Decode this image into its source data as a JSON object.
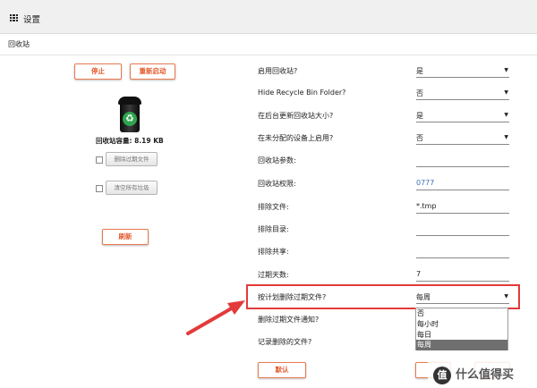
{
  "app": {
    "title": "设置",
    "grid_icon": "grid-icon"
  },
  "breadcrumb": "回收站",
  "left": {
    "stop_button": "停止",
    "restart_button": "重新启动",
    "trash_icon": "trash-can-icon",
    "recycle_symbol": "♻",
    "usage": "回收站容量: 8.19 KB",
    "delete_expired_button": "删除过期文件",
    "empty_all_button": "清空所有垃圾",
    "refresh_button": "刷新"
  },
  "settings": {
    "enable_recycle": {
      "label": "启用回收站?",
      "value": "是"
    },
    "hide_folder": {
      "label": "Hide Recycle Bin Folder?",
      "value": "否"
    },
    "update_size_bg": {
      "label": "在后台更新回收站大小?",
      "value": "是"
    },
    "enable_unassigned": {
      "label": "在未分配的设备上启用?",
      "value": "否"
    },
    "recycle_params": {
      "label": "回收站参数:",
      "value": ""
    },
    "recycle_perms": {
      "label": "回收站权限:",
      "value": "0777"
    },
    "exclude_files": {
      "label": "排除文件:",
      "value": "*.tmp"
    },
    "exclude_dirs": {
      "label": "排除目录:",
      "value": ""
    },
    "exclude_shares": {
      "label": "排除共享:",
      "value": ""
    },
    "expire_days": {
      "label": "过期天数:",
      "value": "7"
    },
    "schedule_delete": {
      "label": "按计划删除过期文件?",
      "value": "每周"
    },
    "notify_delete": {
      "label": "删除过期文件通知?"
    },
    "log_deleted": {
      "label": "记录删除的文件?"
    }
  },
  "dropdown_options": [
    "否",
    "每小时",
    "每日",
    "每周"
  ],
  "footer": {
    "default_button": "默认"
  },
  "watermark": {
    "badge": "值",
    "text": "什么值得买"
  },
  "colors": {
    "accent": "#e4572a",
    "highlight": "#e33a3a",
    "link": "#3d72b5",
    "selected_option": "#6f6f6f"
  }
}
